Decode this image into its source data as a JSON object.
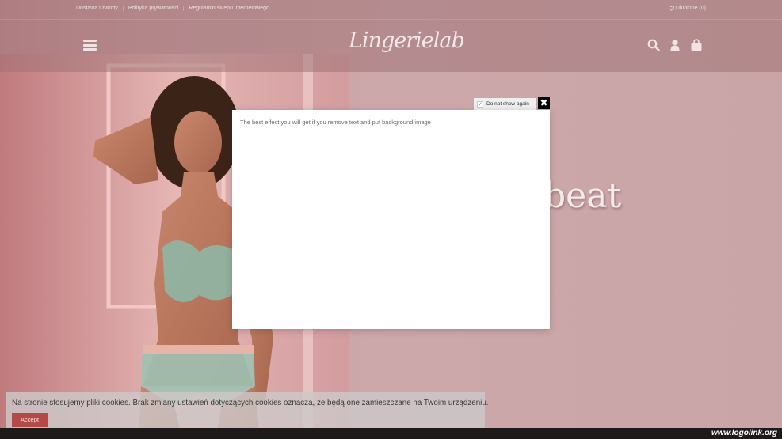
{
  "top_bar": {
    "links": [
      "Dostawa i zwroty",
      "Polityka prywatności",
      "Regulamin sklepu internetowego"
    ],
    "wishlist_label": "Ulubione (0)"
  },
  "header": {
    "logo_text": "Lingerielab",
    "icons": [
      "menu-icon",
      "search-icon",
      "user-icon",
      "shopping-bag-icon"
    ]
  },
  "hero": {
    "partial_text": "beat"
  },
  "popup": {
    "dont_show_label": "Do not show again",
    "close_label": "✖",
    "body_text": "The best effect you will get if you remove text and put background image"
  },
  "cookie_bar": {
    "message": "Na stronie stosujemy pliki cookies. Brak zmiany ustawień dotyczących cookies oznacza, że będą one zamieszczane na Twoim urządzeniu.",
    "accept_label": "Accept"
  },
  "watermark": {
    "text": "www.logolink.org"
  },
  "colors": {
    "header_overlay": "#a07376",
    "accept_button": "#b34a47",
    "close_button": "#000000"
  }
}
